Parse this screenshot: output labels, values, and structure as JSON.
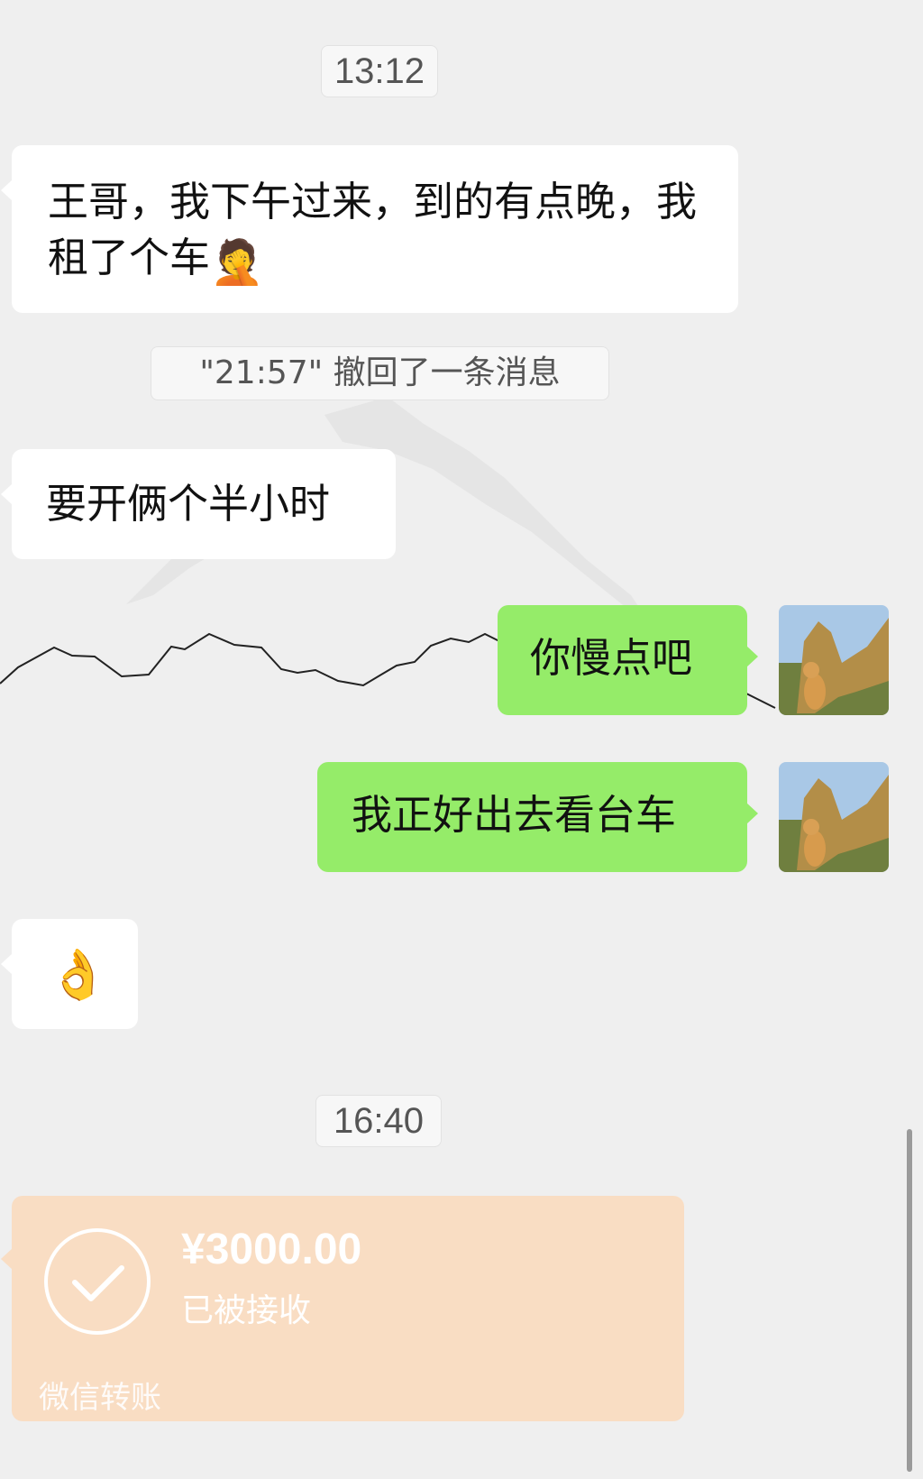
{
  "chat": {
    "timestamps": [
      "13:12",
      "16:40"
    ],
    "recall_notice": "\"21:57\" 撤回了一条消息",
    "messages": [
      {
        "direction": "incoming",
        "text": "王哥，我下午过来，到的有点晚，我租了个车",
        "emoji": "🤦"
      },
      {
        "direction": "incoming",
        "text": "要开俩个半小时"
      },
      {
        "direction": "outgoing",
        "text": "你慢点吧"
      },
      {
        "direction": "outgoing",
        "text": "我正好出去看台车"
      },
      {
        "direction": "incoming",
        "emoji": "👌"
      }
    ],
    "transfer": {
      "amount": "¥3000.00",
      "status": "已被接收",
      "label": "微信转账",
      "color": "#f9ddc3"
    }
  },
  "colors": {
    "background": "#efefef",
    "incoming_bubble": "#ffffff",
    "outgoing_bubble": "#95ec69"
  },
  "icons": [
    "my-avatar-icon",
    "check-icon"
  ]
}
